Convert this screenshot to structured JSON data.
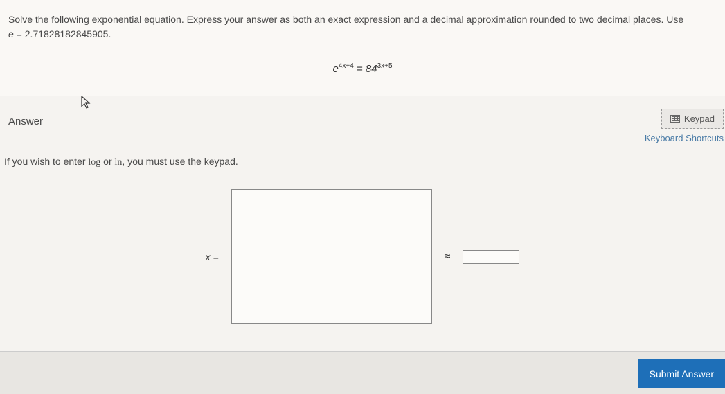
{
  "question": {
    "text_line1": "Solve the following exponential equation. Express your answer as both an exact expression and a decimal approximation rounded to two decimal places. Use",
    "e_var": "e",
    "equals": " = ",
    "e_value": "2.71828182845905.",
    "equation_base_left": "e",
    "equation_exp_left": "4x+4",
    "equation_eq": " = ",
    "equation_base_right": "84",
    "equation_exp_right": "3x+5"
  },
  "answer": {
    "label": "Answer",
    "keypad_label": "Keypad",
    "shortcuts_label": "Keyboard Shortcuts",
    "hint_prefix": "If you wish to enter ",
    "hint_log": "log",
    "hint_or": " or ",
    "hint_ln": "ln",
    "hint_suffix": ", you must use the keypad.",
    "x_equals": "x =",
    "approx_symbol": "≈",
    "approx_value": ""
  },
  "footer": {
    "submit_label": "Submit Answer"
  }
}
